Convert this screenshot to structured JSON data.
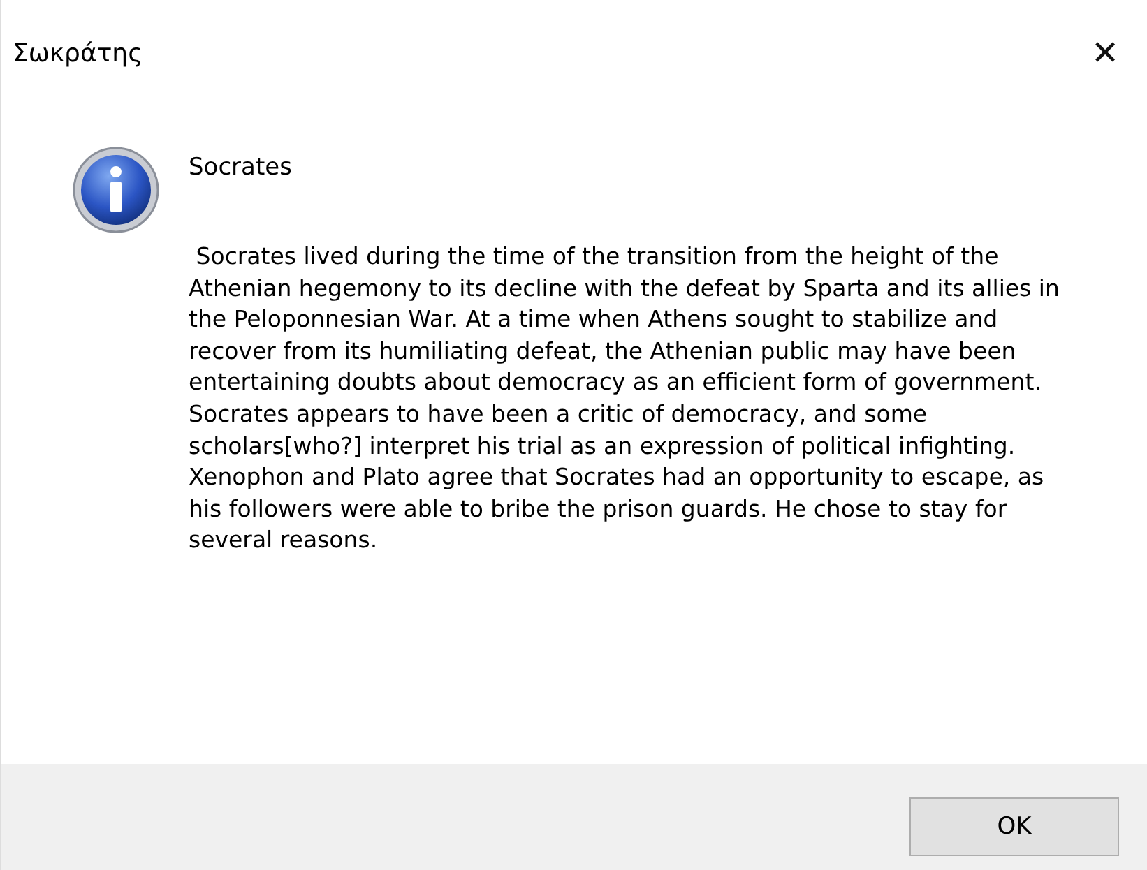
{
  "window": {
    "title": "Σωκράτης",
    "close": "✕"
  },
  "message": {
    "heading": "Socrates",
    "body": " Socrates lived during the time of the transition from the height of the Athenian hegemony to its decline with the defeat by Sparta and its allies in the Peloponnesian War. At a time when Athens sought to stabilize and recover from its humiliating defeat, the Athenian public may have been entertaining doubts about democracy as an efficient form of government. Socrates appears to have been a critic of democracy, and some scholars[who?] interpret his trial as an expression of political infighting.\nXenophon and Plato agree that Socrates had an opportunity to escape, as his followers were able to bribe the prison guards. He chose to stay for several reasons."
  },
  "buttons": [
    "OK"
  ]
}
